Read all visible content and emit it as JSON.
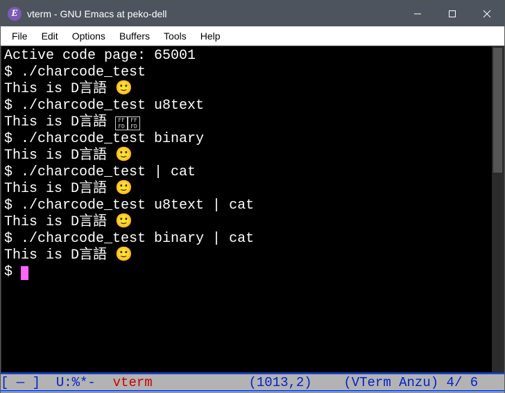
{
  "window": {
    "title": "vterm - GNU Emacs at peko-dell",
    "icon_letter": "E"
  },
  "menus": [
    "File",
    "Edit",
    "Options",
    "Buffers",
    "Tools",
    "Help"
  ],
  "terminal": {
    "lines": [
      {
        "text": "Active code page: 65001"
      },
      {
        "prompt": "$ ",
        "cmd": "./charcode_test"
      },
      {
        "text": "This is D言語 ",
        "emoji": "🙂"
      },
      {
        "prompt": "$ ",
        "cmd": "./charcode_test u8text"
      },
      {
        "text": "This is D言語 ",
        "tofu": [
          "FF\nFD",
          "FF\nFD"
        ]
      },
      {
        "prompt": "$ ",
        "cmd": "./charcode_test binary"
      },
      {
        "text": "This is D言語 ",
        "emoji": "🙂"
      },
      {
        "prompt": "$ ",
        "cmd": "./charcode_test | cat"
      },
      {
        "text": "This is D言語 ",
        "emoji": "🙂"
      },
      {
        "prompt": "$ ",
        "cmd": "./charcode_test u8text | cat"
      },
      {
        "text": "This is D言語 ",
        "emoji": "🙂"
      },
      {
        "prompt": "$ ",
        "cmd": "./charcode_test binary | cat"
      },
      {
        "text": "This is D言語 ",
        "emoji": "🙂"
      },
      {
        "prompt": "$ ",
        "cursor": true
      }
    ]
  },
  "modeline": {
    "status": "[ — ]  U:%*-  ",
    "buffer": "vterm",
    "spacer": "            ",
    "position": "(1013,2)",
    "spacer2": "    ",
    "mode": "(VTerm Anzu) 4/ 6"
  }
}
